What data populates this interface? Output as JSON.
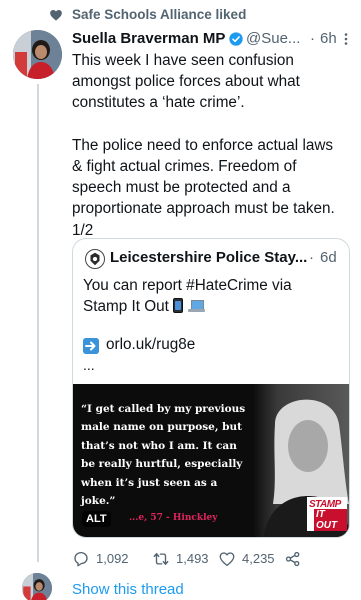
{
  "social_context": {
    "text": "Safe Schools Alliance liked"
  },
  "tweet": {
    "author_name": "Suella Braverman MP",
    "handle": "@Sue...",
    "time": "6h",
    "text": "This week I have seen confusion\namongst police forces about what\nconstitutes a ‘hate crime’.\n\nThe police need to enforce actual laws\n& fight actual crimes. Freedom of\nspeech must be protected and a\nproportionate approach must be taken.\n1/2"
  },
  "quote": {
    "author_name": "Leicestershire Police Stay...",
    "time": "6d",
    "text_line1": "You can report #HateCrime via",
    "text_line2": "Stamp It Out",
    "link": "orlo.uk/rug8e",
    "ellipsis": "...",
    "media": {
      "quote_lines": [
        "“I get called by my previous",
        "male name on purpose, but",
        "that’s not who I am. It can",
        "be really hurtful, especially",
        "when it’s just seen as a",
        "joke.”"
      ],
      "attribution": "...e, 57 - Hinckley",
      "alt": "ALT",
      "logo_line1": "STAMP",
      "logo_line2": "IT OUT"
    }
  },
  "actions": {
    "replies": "1,092",
    "retweets": "1,493",
    "likes": "4,235"
  },
  "show_thread": "Show this thread",
  "colors": {
    "accent": "#1d9bf0",
    "muted": "#536471",
    "verified": "#1d9bf0"
  }
}
